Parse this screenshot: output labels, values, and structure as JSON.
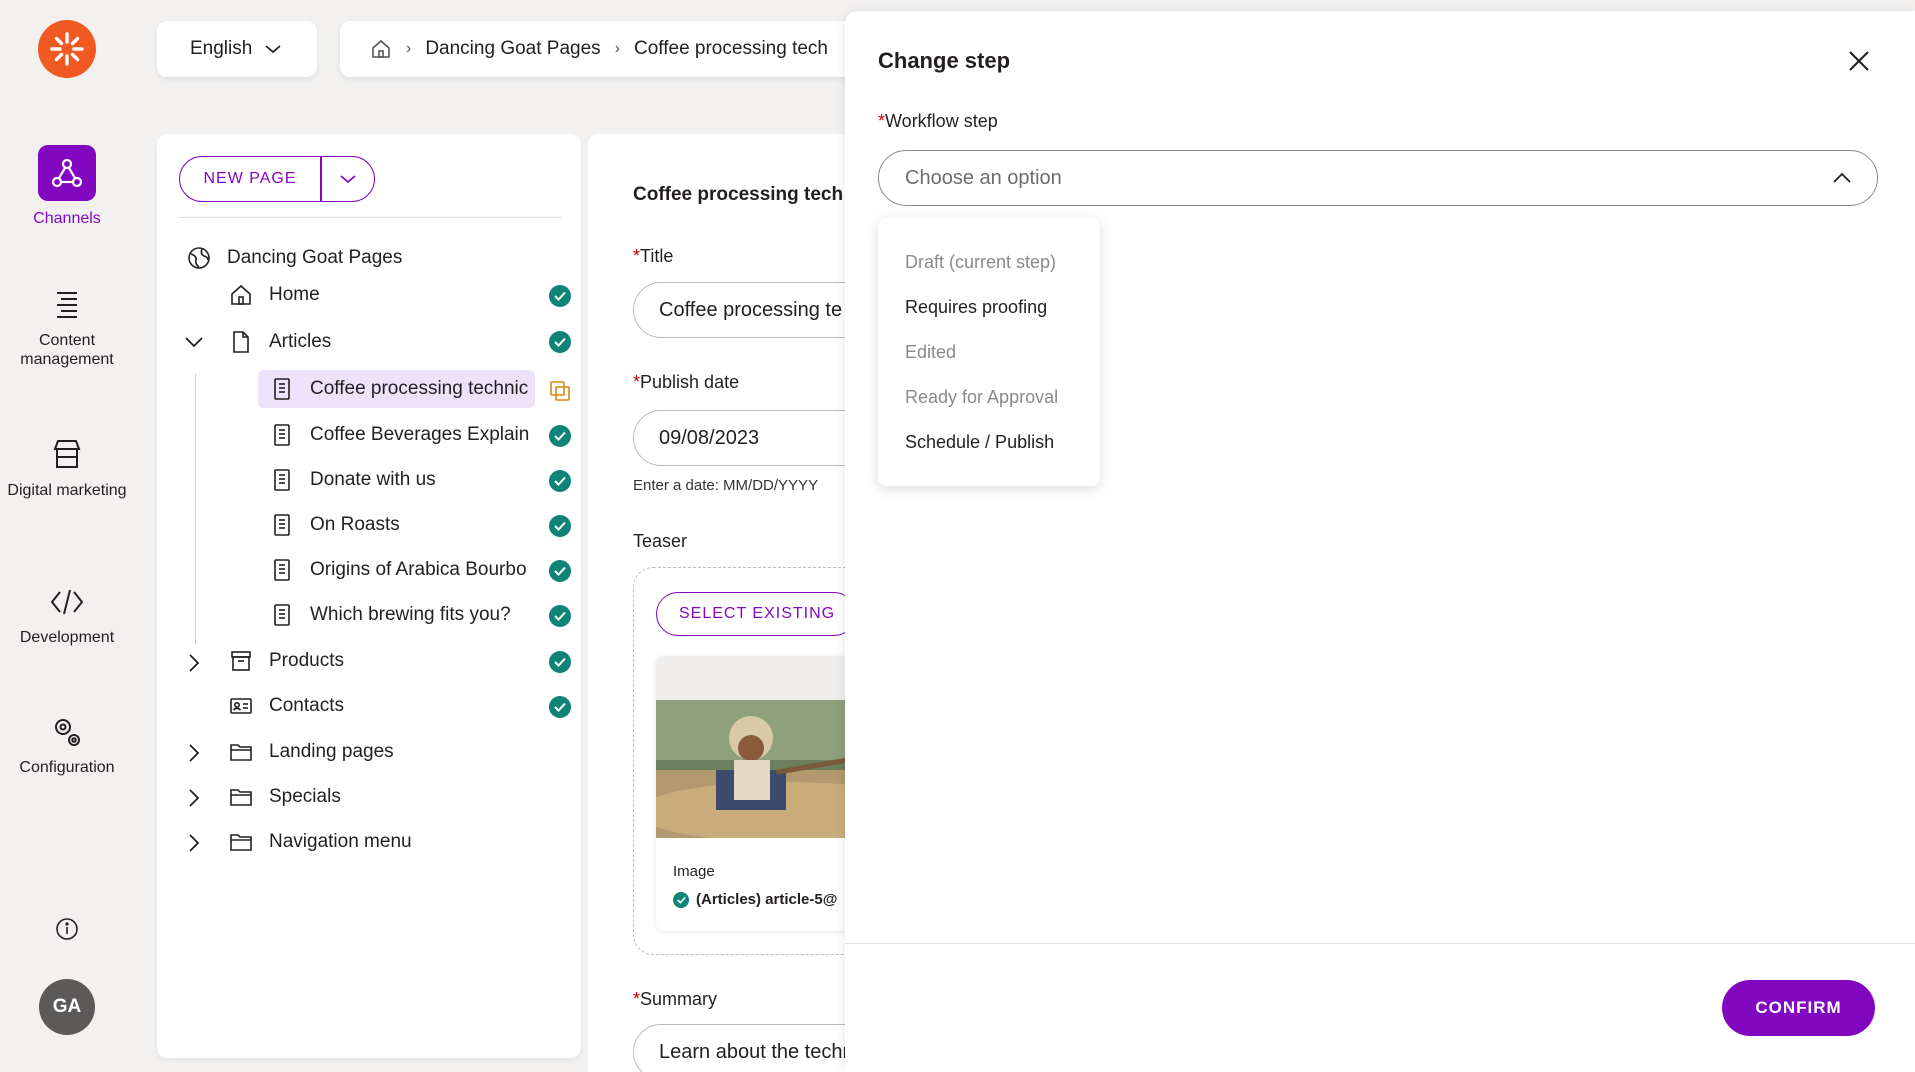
{
  "rail": {
    "items": [
      {
        "label": "Channels",
        "active": true
      },
      {
        "label": "Content management"
      },
      {
        "label": "Digital marketing"
      },
      {
        "label": "Development"
      },
      {
        "label": "Configuration"
      }
    ],
    "avatar_initials": "GA"
  },
  "topbar": {
    "language": "English",
    "breadcrumbs": [
      "Dancing Goat Pages",
      "Coffee processing tech"
    ]
  },
  "tree": {
    "new_page_label": "NEW PAGE",
    "root": "Dancing Goat Pages",
    "nodes": [
      {
        "label": "Home"
      },
      {
        "label": "Articles"
      },
      {
        "label": "Coffee processing technic"
      },
      {
        "label": "Coffee Beverages Explain"
      },
      {
        "label": "Donate with us"
      },
      {
        "label": "On Roasts"
      },
      {
        "label": "Origins of Arabica Bourbo"
      },
      {
        "label": "Which brewing fits you?"
      },
      {
        "label": "Products"
      },
      {
        "label": "Contacts"
      },
      {
        "label": "Landing pages"
      },
      {
        "label": "Specials"
      },
      {
        "label": "Navigation menu"
      }
    ]
  },
  "editor": {
    "heading": "Coffee processing tech",
    "title_label": "Title",
    "title_value": "Coffee processing te",
    "publish_label": "Publish date",
    "publish_value": "09/08/2023",
    "date_hint": "Enter a date: MM/DD/YYYY",
    "teaser_label": "Teaser",
    "select_existing": "SELECT EXISTING",
    "asset_label": "Image",
    "asset_name": "(Articles) article-5@",
    "summary_label": "Summary",
    "summary_value": "Learn about the techniques of processing the products of coffee plants. Different methods are used in"
  },
  "modal": {
    "title": "Change step",
    "field_label": "Workflow step",
    "placeholder": "Choose an option",
    "options": [
      {
        "label": "Draft (current step)",
        "disabled": true
      },
      {
        "label": "Requires proofing",
        "disabled": false
      },
      {
        "label": "Edited",
        "disabled": true
      },
      {
        "label": "Ready for Approval",
        "disabled": true
      },
      {
        "label": "Schedule / Publish",
        "disabled": false
      }
    ],
    "confirm_label": "CONFIRM"
  },
  "colors": {
    "accent": "#8107c1",
    "brand": "#f05a22",
    "success": "#0e8478"
  }
}
